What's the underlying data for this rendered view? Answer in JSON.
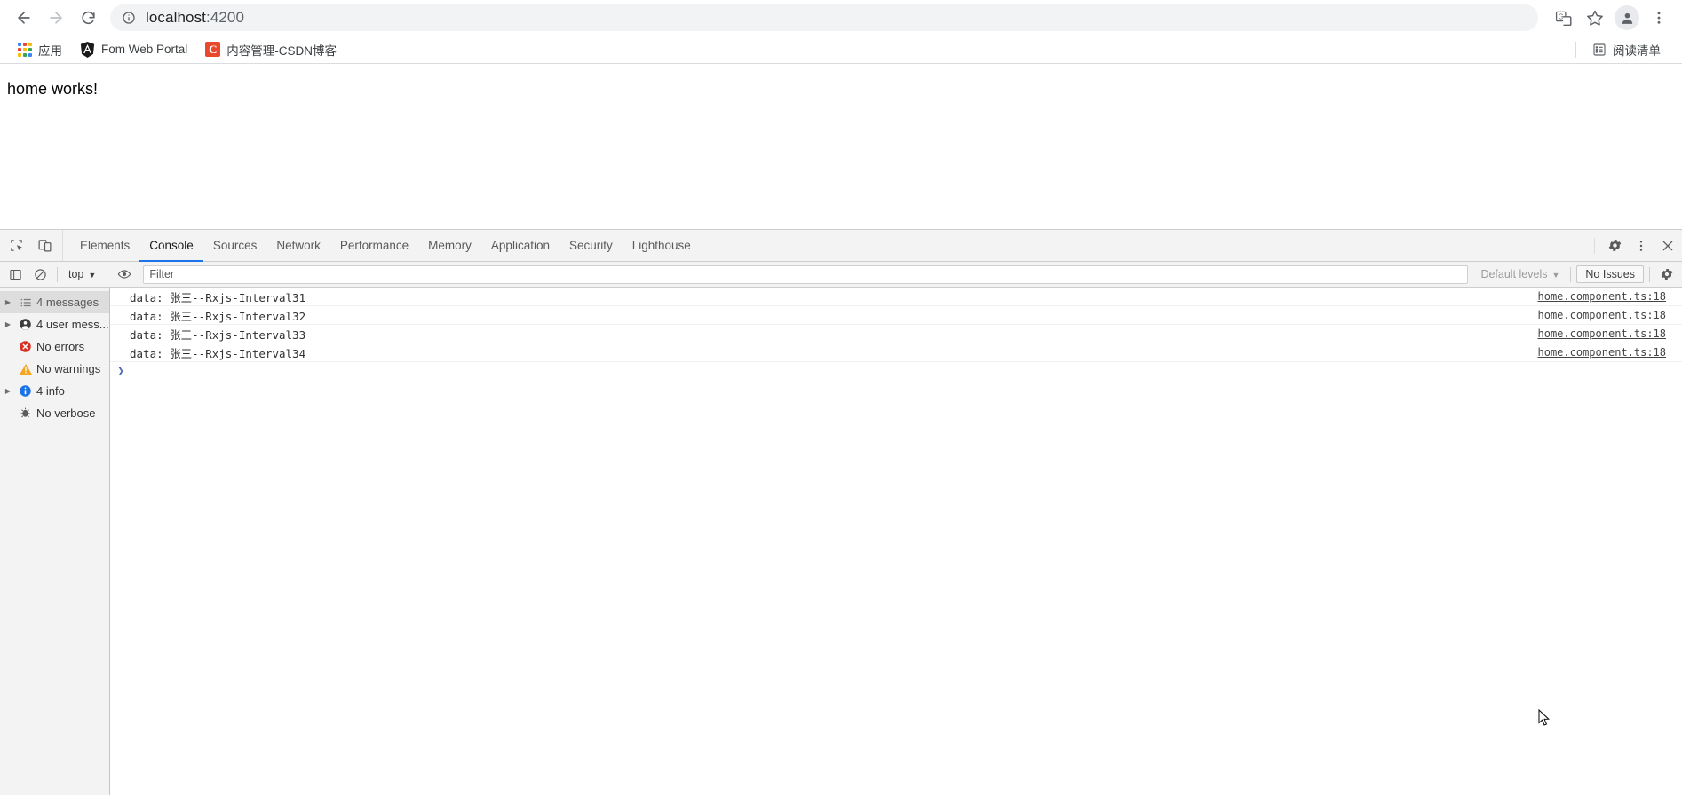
{
  "browser": {
    "back_label": "back-arrow",
    "forward_label": "forward-arrow",
    "reload_label": "reload",
    "url_main": "localhost",
    "url_suffix": ":4200",
    "site_info_icon": "info-circle-icon",
    "translate_icon": "translate-icon",
    "bookmark_icon": "star-icon",
    "profile_icon": "profile-avatar-icon",
    "menu_icon": "three-dot-menu-icon"
  },
  "bookmarks": {
    "items": [
      {
        "label": "应用",
        "icon": "apps-grid-icon"
      },
      {
        "label": "Fom Web Portal",
        "icon": "angular-logo-icon"
      },
      {
        "label": "内容管理-CSDN博客",
        "icon": "csdn-logo-icon"
      }
    ],
    "reading_list": {
      "label": "阅读清单",
      "icon": "reading-list-icon"
    }
  },
  "page": {
    "heading": "home works!"
  },
  "devtools": {
    "left_tools": [
      {
        "name": "inspect-element-icon"
      },
      {
        "name": "device-toolbar-icon"
      }
    ],
    "tabs": [
      {
        "label": "Elements",
        "active": false
      },
      {
        "label": "Console",
        "active": true
      },
      {
        "label": "Sources",
        "active": false
      },
      {
        "label": "Network",
        "active": false
      },
      {
        "label": "Performance",
        "active": false
      },
      {
        "label": "Memory",
        "active": false
      },
      {
        "label": "Application",
        "active": false
      },
      {
        "label": "Security",
        "active": false
      },
      {
        "label": "Lighthouse",
        "active": false
      }
    ],
    "right_tools": [
      {
        "name": "settings-gear-icon"
      },
      {
        "name": "more-options-icon"
      },
      {
        "name": "close-devtools-icon"
      }
    ],
    "console_toolbar": {
      "sidebar_toggle_icon": "show-console-sidebar-icon",
      "clear_console_icon": "clear-console-icon",
      "context_selector": "top",
      "live_expression_icon": "eye-icon",
      "filter_placeholder": "Filter",
      "filter_value": "",
      "levels_label": "Default levels",
      "issues_label": "No Issues",
      "settings_icon": "console-settings-gear-icon"
    },
    "sidebar": {
      "items": [
        {
          "label": "4 messages",
          "icon": "list-icon",
          "arrow": true,
          "selected": true
        },
        {
          "label": "4 user mess...",
          "icon": "user-icon",
          "arrow": true,
          "selected": false
        },
        {
          "label": "No errors",
          "icon": "error-icon",
          "arrow": false,
          "selected": false
        },
        {
          "label": "No warnings",
          "icon": "warning-icon",
          "arrow": false,
          "selected": false
        },
        {
          "label": "4 info",
          "icon": "info-icon",
          "arrow": true,
          "selected": false
        },
        {
          "label": "No verbose",
          "icon": "verbose-icon",
          "arrow": false,
          "selected": false
        }
      ]
    },
    "messages": [
      {
        "text": "data: 张三--Rxjs-Interval31",
        "source": "home.component.ts:18"
      },
      {
        "text": "data: 张三--Rxjs-Interval32",
        "source": "home.component.ts:18"
      },
      {
        "text": "data: 张三--Rxjs-Interval33",
        "source": "home.component.ts:18"
      },
      {
        "text": "data: 张三--Rxjs-Interval34",
        "source": "home.component.ts:18"
      }
    ],
    "prompt_symbol": "❯"
  },
  "colors": {
    "accent_blue": "#1a73e8",
    "error_red": "#d93025",
    "warning_orange": "#f5a623",
    "info_blue": "#1a73e8",
    "csdn_orange": "#e8492c",
    "toolbar_gray": "#f3f3f3"
  }
}
